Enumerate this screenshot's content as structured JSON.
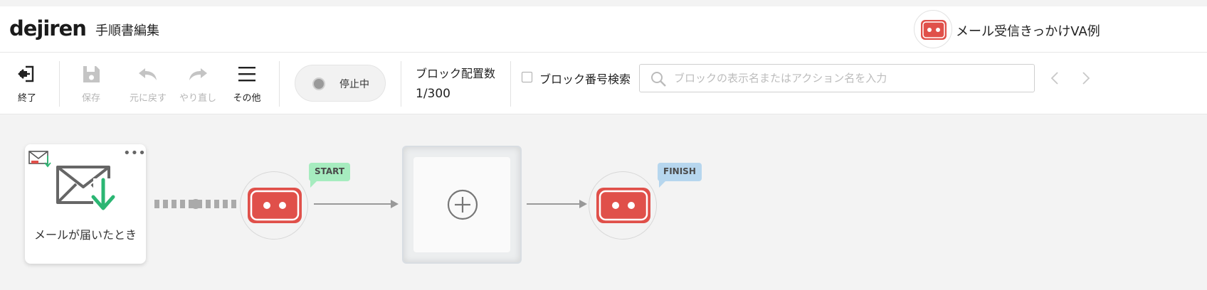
{
  "header": {
    "logo": "dejiren",
    "page_title": "手順書編集",
    "bot_name": "メール受信きっかけVA例"
  },
  "toolbar": {
    "exit_label": "終了",
    "save_label": "保存",
    "undo_label": "元に戻す",
    "redo_label": "やり直し",
    "more_label": "その他",
    "status_label": "停止中",
    "block_count_label": "ブロック配置数",
    "block_count_value": "1/300",
    "block_number_search_label": "ブロック番号検索",
    "search_placeholder": "ブロックの表示名またはアクション名を入力"
  },
  "canvas": {
    "trigger_caption": "メールが届いたとき",
    "start_tag": "START",
    "finish_tag": "FINISH"
  },
  "colors": {
    "robot_red": "#e0504a",
    "start_green": "#a6ecbf",
    "finish_blue": "#b6d6ee",
    "accent_green": "#2bb673"
  },
  "icons": {
    "exit": "exit-icon",
    "save": "save-icon",
    "undo": "undo-icon",
    "redo": "redo-icon",
    "menu": "menu-icon",
    "search": "search-icon",
    "trigger": "mail-received-icon"
  }
}
